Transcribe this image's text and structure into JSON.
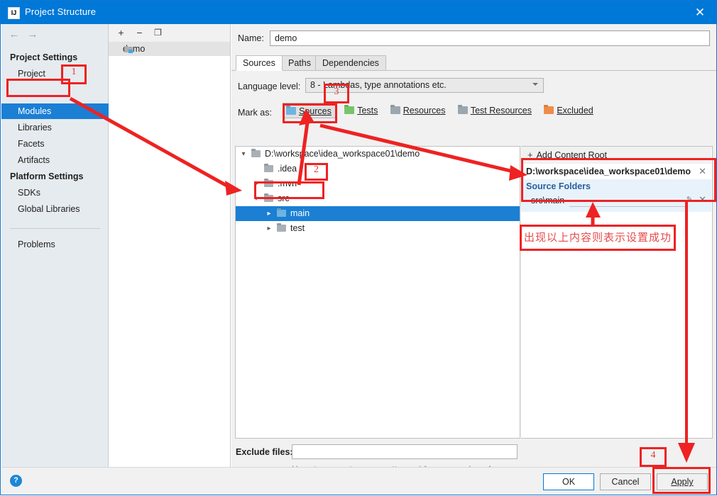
{
  "window": {
    "title": "Project Structure",
    "icon": "intellij-idea-icon",
    "close_label": "✕"
  },
  "sidebar": {
    "nav": {
      "back": "←",
      "forward": "→"
    },
    "groups": [
      {
        "heading": "Project Settings",
        "items": [
          "Project",
          "Modules",
          "Libraries",
          "Facets",
          "Artifacts"
        ]
      },
      {
        "heading": "Platform Settings",
        "items": [
          "SDKs",
          "Global Libraries"
        ]
      }
    ],
    "selected": "Modules",
    "footer_item": "Problems"
  },
  "modules_panel": {
    "toolbar": {
      "add": "+",
      "remove": "−",
      "copy": "❐"
    },
    "items": [
      {
        "label": "demo",
        "selected": true
      }
    ]
  },
  "main": {
    "name_label": "Name:",
    "name_value": "demo",
    "tabs": [
      {
        "label": "Sources",
        "active": true
      },
      {
        "label": "Paths",
        "active": false
      },
      {
        "label": "Dependencies",
        "active": false
      }
    ],
    "language_level": {
      "label": "Language level:",
      "value": "8 - Lambdas, type annotations etc."
    },
    "mark_as": {
      "label": "Mark as:",
      "options": [
        {
          "label": "Sources",
          "color": "#6fb4e0",
          "pressed": true
        },
        {
          "label": "Tests",
          "color": "#78c46a",
          "pressed": false
        },
        {
          "label": "Resources",
          "color": "#9aa7b0",
          "pressed": false
        },
        {
          "label": "Test Resources",
          "color": "#9aa7b0",
          "pressed": false
        },
        {
          "label": "Excluded",
          "color": "#ef8d48",
          "pressed": false
        }
      ]
    },
    "tree": [
      {
        "label": "D:\\workspace\\idea_workspace01\\demo",
        "depth": 0,
        "chevron": "down",
        "color": "#a8b0b6",
        "selected": false
      },
      {
        "label": ".idea",
        "depth": 1,
        "chevron": "none",
        "color": "#a8b0b6",
        "selected": false
      },
      {
        "label": ".mvn",
        "depth": 1,
        "chevron": "right",
        "color": "#a8b0b6",
        "selected": false
      },
      {
        "label": "src",
        "depth": 1,
        "chevron": "down",
        "color": "#a8b0b6",
        "selected": false
      },
      {
        "label": "main",
        "depth": 2,
        "chevron": "right",
        "color": "#6fb4e0",
        "selected": true
      },
      {
        "label": "test",
        "depth": 2,
        "chevron": "right",
        "color": "#a8b0b6",
        "selected": false
      }
    ],
    "content_roots": {
      "add_label": "Add Content Root",
      "add_accel": "C",
      "root_path": "D:\\workspace\\idea_workspace01\\demo",
      "remove_label": "✕",
      "source_folders_title": "Source Folders",
      "source_folders": [
        "src\\main"
      ],
      "edit_label": "✎"
    },
    "exclude": {
      "label": "Exclude files:",
      "value": "",
      "hint": "Use ; to separate name patterns, * for any number of symbols, ? for one."
    }
  },
  "bottom": {
    "help": "?",
    "ok": "OK",
    "cancel": "Cancel",
    "apply": "Apply"
  },
  "annotations": {
    "numbers": [
      "1",
      "2",
      "3",
      "4"
    ],
    "note_cn": "出现以上内容则表示设置成功",
    "color": "#ee2222"
  }
}
